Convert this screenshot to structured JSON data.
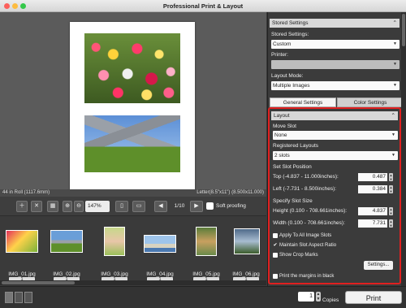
{
  "window": {
    "title": "Professional Print & Layout"
  },
  "status": {
    "roll": "44 in Roll (1117.6mm)",
    "paper": "Letter(8.5\"x11\") (8.500x11.000)"
  },
  "toolbar": {
    "zoom": "147%",
    "page": "1/10",
    "soft_proofing": "Soft proofing"
  },
  "thumbnails": [
    {
      "name": "IMG_01.jpg",
      "count": "1"
    },
    {
      "name": "IMG_02.jpg",
      "count": "1"
    },
    {
      "name": "IMG_03.jpg",
      "count": "1"
    },
    {
      "name": "IMG_04.jpg",
      "count": "1"
    },
    {
      "name": "IMG_05.jpg",
      "count": "1"
    },
    {
      "name": "IMG_06.jpg",
      "count": "1"
    }
  ],
  "panel": {
    "stored_settings_header": "Stored Settings",
    "stored_settings_label": "Stored Settings:",
    "stored_settings_value": "Custom",
    "printer_label": "Printer:",
    "layout_mode_label": "Layout Mode:",
    "layout_mode_value": "Multiple Images",
    "tab_general": "General Settings",
    "tab_color": "Color Settings",
    "layout_header": "Layout",
    "move_slot_label": "Move Slot",
    "move_slot_value": "None",
    "registered_layouts_label": "Registered Layouts",
    "registered_layouts_value": "2 slots",
    "set_slot_position_label": "Set Slot Position",
    "top_label": "Top (-4.837 - 11.000inches):",
    "top_value": "0.487",
    "left_label": "Left (-7.731 - 8.500inches):",
    "left_value": "0.384",
    "specify_size_label": "Specify Slot Size",
    "height_label": "Height (0.100 - 708.661inches):",
    "height_value": "4.837",
    "width_label": "Width (0.100 - 708.661inches):",
    "width_value": "7.731",
    "apply_all": "Apply To All Image Slots",
    "maintain_aspect": "Maintain Slot Aspect Ratio",
    "show_crop": "Show Crop Marks",
    "settings_button": "Settings...",
    "print_margins": "Print the margins in black"
  },
  "bottom": {
    "copies_value": "1",
    "copies_label": "Copies",
    "print_label": "Print"
  }
}
